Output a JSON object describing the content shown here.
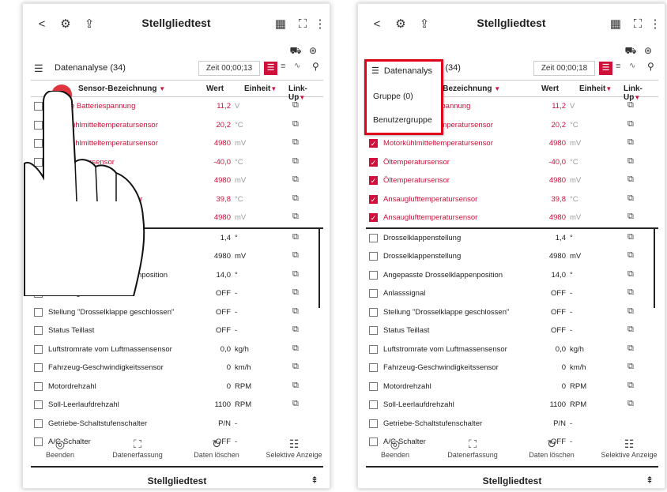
{
  "left": {
    "header": {
      "title": "Stellgliedtest",
      "back": "<",
      "more": "⋮"
    },
    "toolbar": {
      "title": "Datenanalyse (34)",
      "timer": "Zeit 00;00;13"
    },
    "columns": {
      "name": "Sensor-Bezeichnung",
      "value": "Wert",
      "unit": "Einheit",
      "link": "Link-Up"
    },
    "rows": [
      {
        "name": "Positive Batteriespannung",
        "value": "11,2",
        "unit": "V"
      },
      {
        "name": "Motorkühlmitteltemperatursensor",
        "value": "20,2",
        "unit": "°C"
      },
      {
        "name": "Motorkühlmitteltemperatursensor",
        "value": "4980",
        "unit": "mV"
      },
      {
        "name": "Öltemperatursensor",
        "value": "-40,0",
        "unit": "°C"
      },
      {
        "name": "Öltemperatursensor",
        "value": "4980",
        "unit": "mV"
      },
      {
        "name": "Ansauglufttemperatursensor",
        "value": "39,8",
        "unit": "°C"
      },
      {
        "name": "Ansauglufttemperatursensor",
        "value": "4980",
        "unit": "mV"
      },
      {
        "name": "Drosselklappenstellung",
        "value": "1,4",
        "unit": "°"
      },
      {
        "name": "Drosselklappenstellung",
        "value": "4980",
        "unit": "mV"
      },
      {
        "name": "Angepasste Drosselklappenposition",
        "value": "14,0",
        "unit": "°"
      },
      {
        "name": "Anlasssignal",
        "value": "OFF",
        "unit": "-"
      },
      {
        "name": "Stellung \"Drosselklappe geschlossen\"",
        "value": "OFF",
        "unit": "-"
      },
      {
        "name": "Status Teillast",
        "value": "OFF",
        "unit": "-"
      },
      {
        "name": "Luftstromrate vom Luftmassensensor",
        "value": "0,0",
        "unit": "kg/h"
      },
      {
        "name": "Fahrzeug-Geschwindigkeitssensor",
        "value": "0",
        "unit": "km/h"
      },
      {
        "name": "Motordrehzahl",
        "value": "0",
        "unit": "RPM"
      },
      {
        "name": "Soll-Leerlaufdrehzahl",
        "value": "1100",
        "unit": "RPM"
      },
      {
        "name": "Getriebe-Schaltstufenschalter",
        "value": "P/N",
        "unit": "-"
      },
      {
        "name": "A/C-Schalter",
        "value": "OFF",
        "unit": "-"
      }
    ],
    "nav": [
      "Beenden",
      "Datenerfassung",
      "Daten löschen",
      "Selektive Anzeige"
    ],
    "footer": "Stellgliedtest"
  },
  "right": {
    "header": {
      "title": "Stellgliedtest",
      "back": "<",
      "more": "⋮"
    },
    "toolbar": {
      "title": "Datenanalyse (34)",
      "timer": "Zeit 00;00;18"
    },
    "popup": {
      "header": "Datenanalys",
      "items": [
        "Gruppe (0)",
        "Benutzergruppe"
      ]
    },
    "nav": [
      "Beenden",
      "Datenerfassung",
      "Daten löschen",
      "Selektive Anzeige"
    ],
    "footer": "Stellgliedtest"
  },
  "colors": {
    "accent": "#d0103a",
    "popup_border": "#e0001a"
  }
}
